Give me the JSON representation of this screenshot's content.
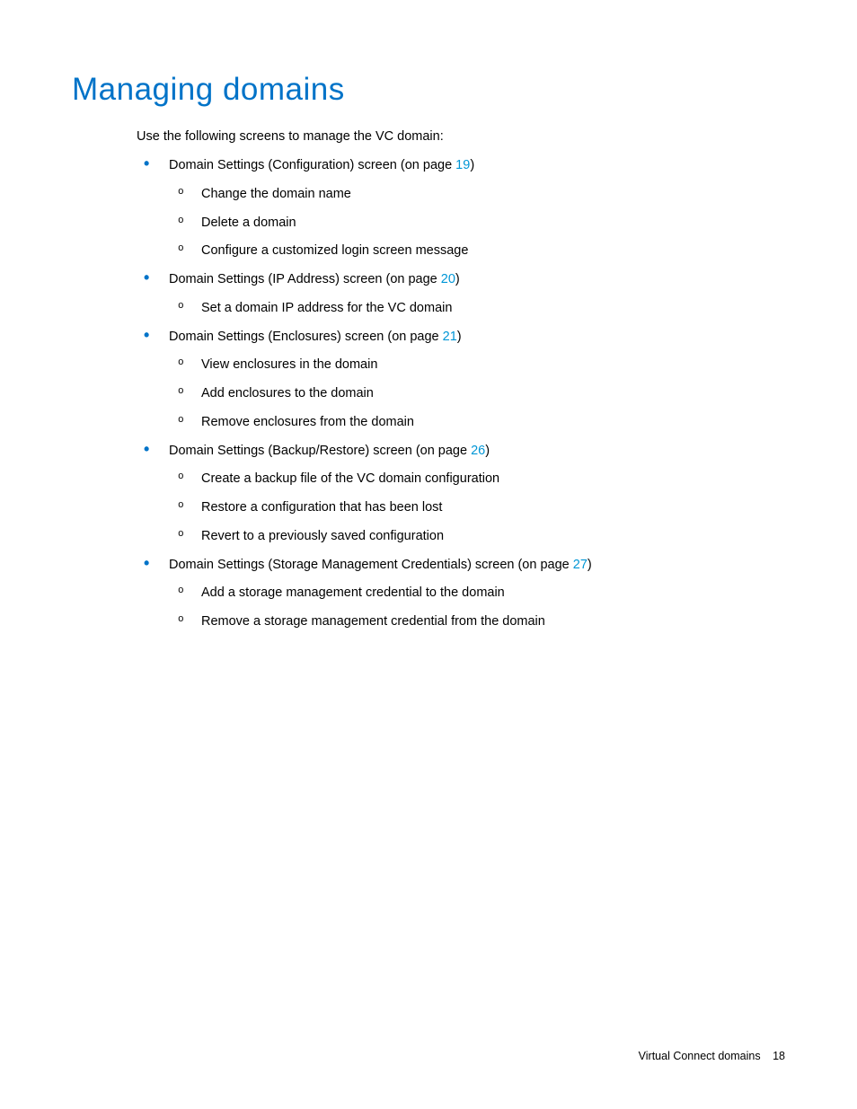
{
  "heading": "Managing domains",
  "intro": "Use the following screens to manage the VC domain:",
  "sections": [
    {
      "text_before": "Domain Settings (Configuration) screen (on page ",
      "page_link": "19",
      "text_after": ")",
      "subitems": [
        "Change the domain name",
        "Delete a domain",
        "Configure a customized login screen message"
      ]
    },
    {
      "text_before": "Domain Settings (IP Address) screen (on page ",
      "page_link": "20",
      "text_after": ")",
      "subitems": [
        "Set a domain IP address for the VC domain"
      ]
    },
    {
      "text_before": "Domain Settings (Enclosures) screen (on page ",
      "page_link": "21",
      "text_after": ")",
      "subitems": [
        "View enclosures in the domain",
        "Add enclosures to the domain",
        "Remove enclosures from the domain"
      ]
    },
    {
      "text_before": "Domain Settings (Backup/Restore) screen (on page ",
      "page_link": "26",
      "text_after": ")",
      "subitems": [
        "Create a backup file of the VC domain configuration",
        "Restore a configuration that has been lost",
        "Revert to a previously saved configuration"
      ]
    },
    {
      "text_before": "Domain Settings (Storage Management Credentials) screen (on page ",
      "page_link": "27",
      "text_after": ")",
      "subitems": [
        "Add a storage management credential to the domain",
        "Remove a storage management credential from the domain"
      ]
    }
  ],
  "footer": {
    "text": "Virtual Connect domains",
    "page": "18"
  }
}
